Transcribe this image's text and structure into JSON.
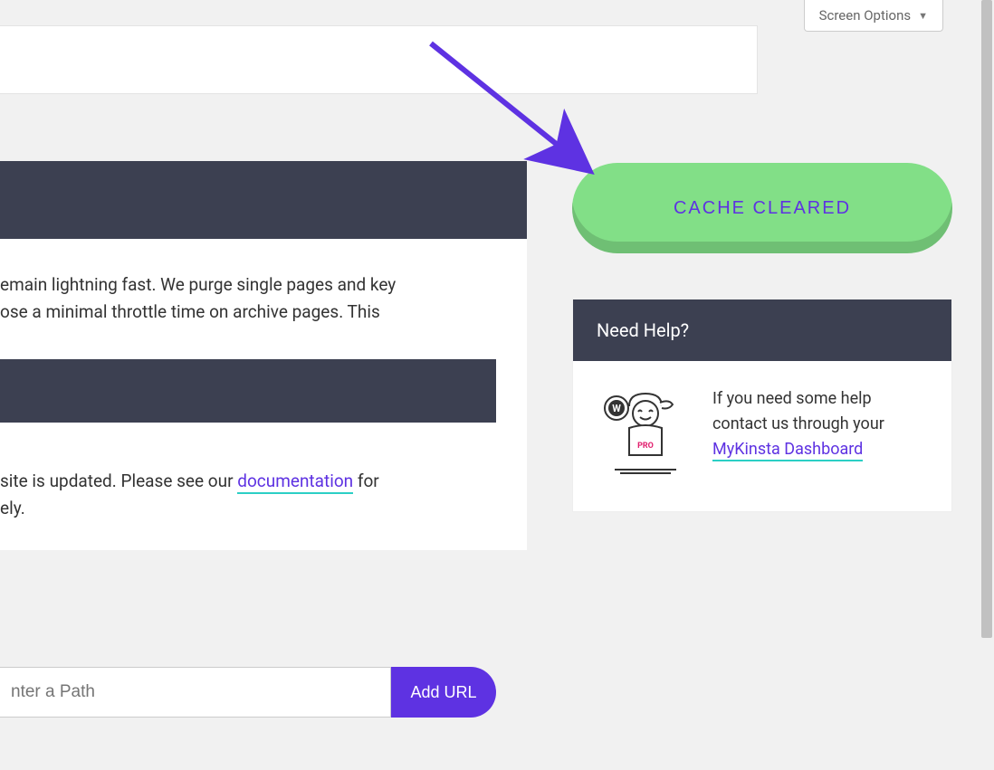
{
  "screen_options": {
    "label": "Screen Options"
  },
  "cache_cleared": {
    "label": "CACHE CLEARED"
  },
  "main": {
    "text1": "emain lightning fast. We purge single pages and key\nose a minimal throttle time on archive pages. This",
    "text2_before": " site is updated. Please see our ",
    "doc_link": "documentation",
    "text2_after": " for\nely."
  },
  "url_form": {
    "placeholder": "nter a Path",
    "add_label": "Add URL"
  },
  "help": {
    "title": "Need Help?",
    "text_before": "If you need some help contact us through your ",
    "link": "MyKinsta Dashboard",
    "pro_label": "PRO"
  }
}
